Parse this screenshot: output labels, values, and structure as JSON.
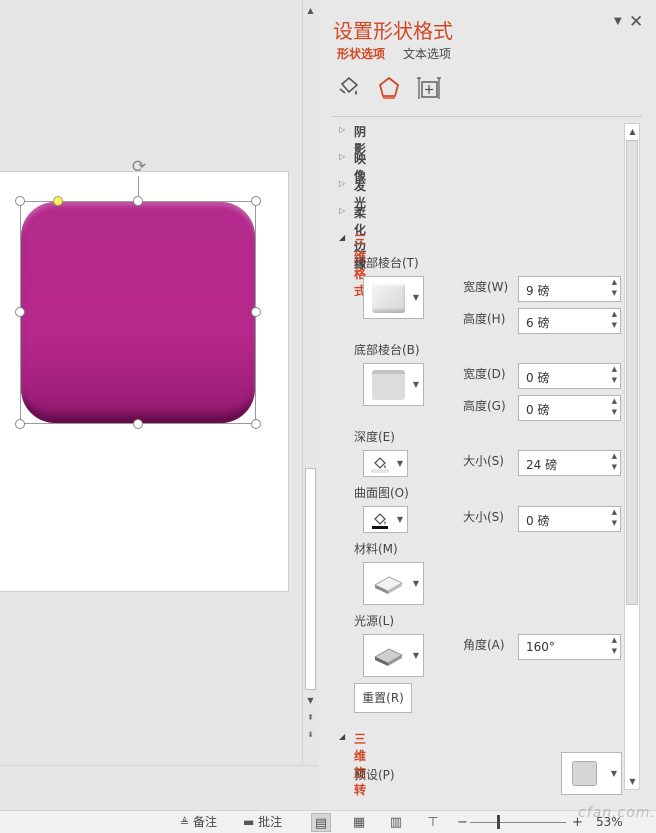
{
  "pane": {
    "title": "设置形状格式",
    "tabs": [
      {
        "label": "形状选项"
      },
      {
        "label": "文本选项"
      }
    ],
    "categories": [
      "fill-line-icon",
      "effects-icon",
      "size-properties-icon"
    ],
    "sections": {
      "shadow": "阴影",
      "reflection": "映像",
      "glow": "发光",
      "soft_edges": "柔化边缘",
      "format_3d": "三维格式",
      "rotation_3d": "三维旋转"
    },
    "format3d": {
      "top_bevel": "顶部棱台(T)",
      "top_width_label": "宽度(W)",
      "top_width_value": "9 磅",
      "top_height_label": "高度(H)",
      "top_height_value": "6 磅",
      "bottom_bevel": "底部棱台(B)",
      "bottom_width_label": "宽度(D)",
      "bottom_width_value": "0 磅",
      "bottom_height_label": "高度(G)",
      "bottom_height_value": "0 磅",
      "depth": "深度(E)",
      "depth_size_label": "大小(S)",
      "depth_size_value": "24 磅",
      "contour": "曲面图(O)",
      "contour_size_label": "大小(S)",
      "contour_size_value": "0 磅",
      "material": "材料(M)",
      "lighting": "光源(L)",
      "angle_label": "角度(A)",
      "angle_value": "160°",
      "reset_label": "重置(R)"
    },
    "rotation3d": {
      "preset_label": "预设(P)"
    }
  },
  "statusbar": {
    "notes": "备注",
    "comments": "批注",
    "zoom": "53%"
  },
  "shape": {
    "fill_color": "#b6288c"
  },
  "watermark": "cfan.com.cn"
}
